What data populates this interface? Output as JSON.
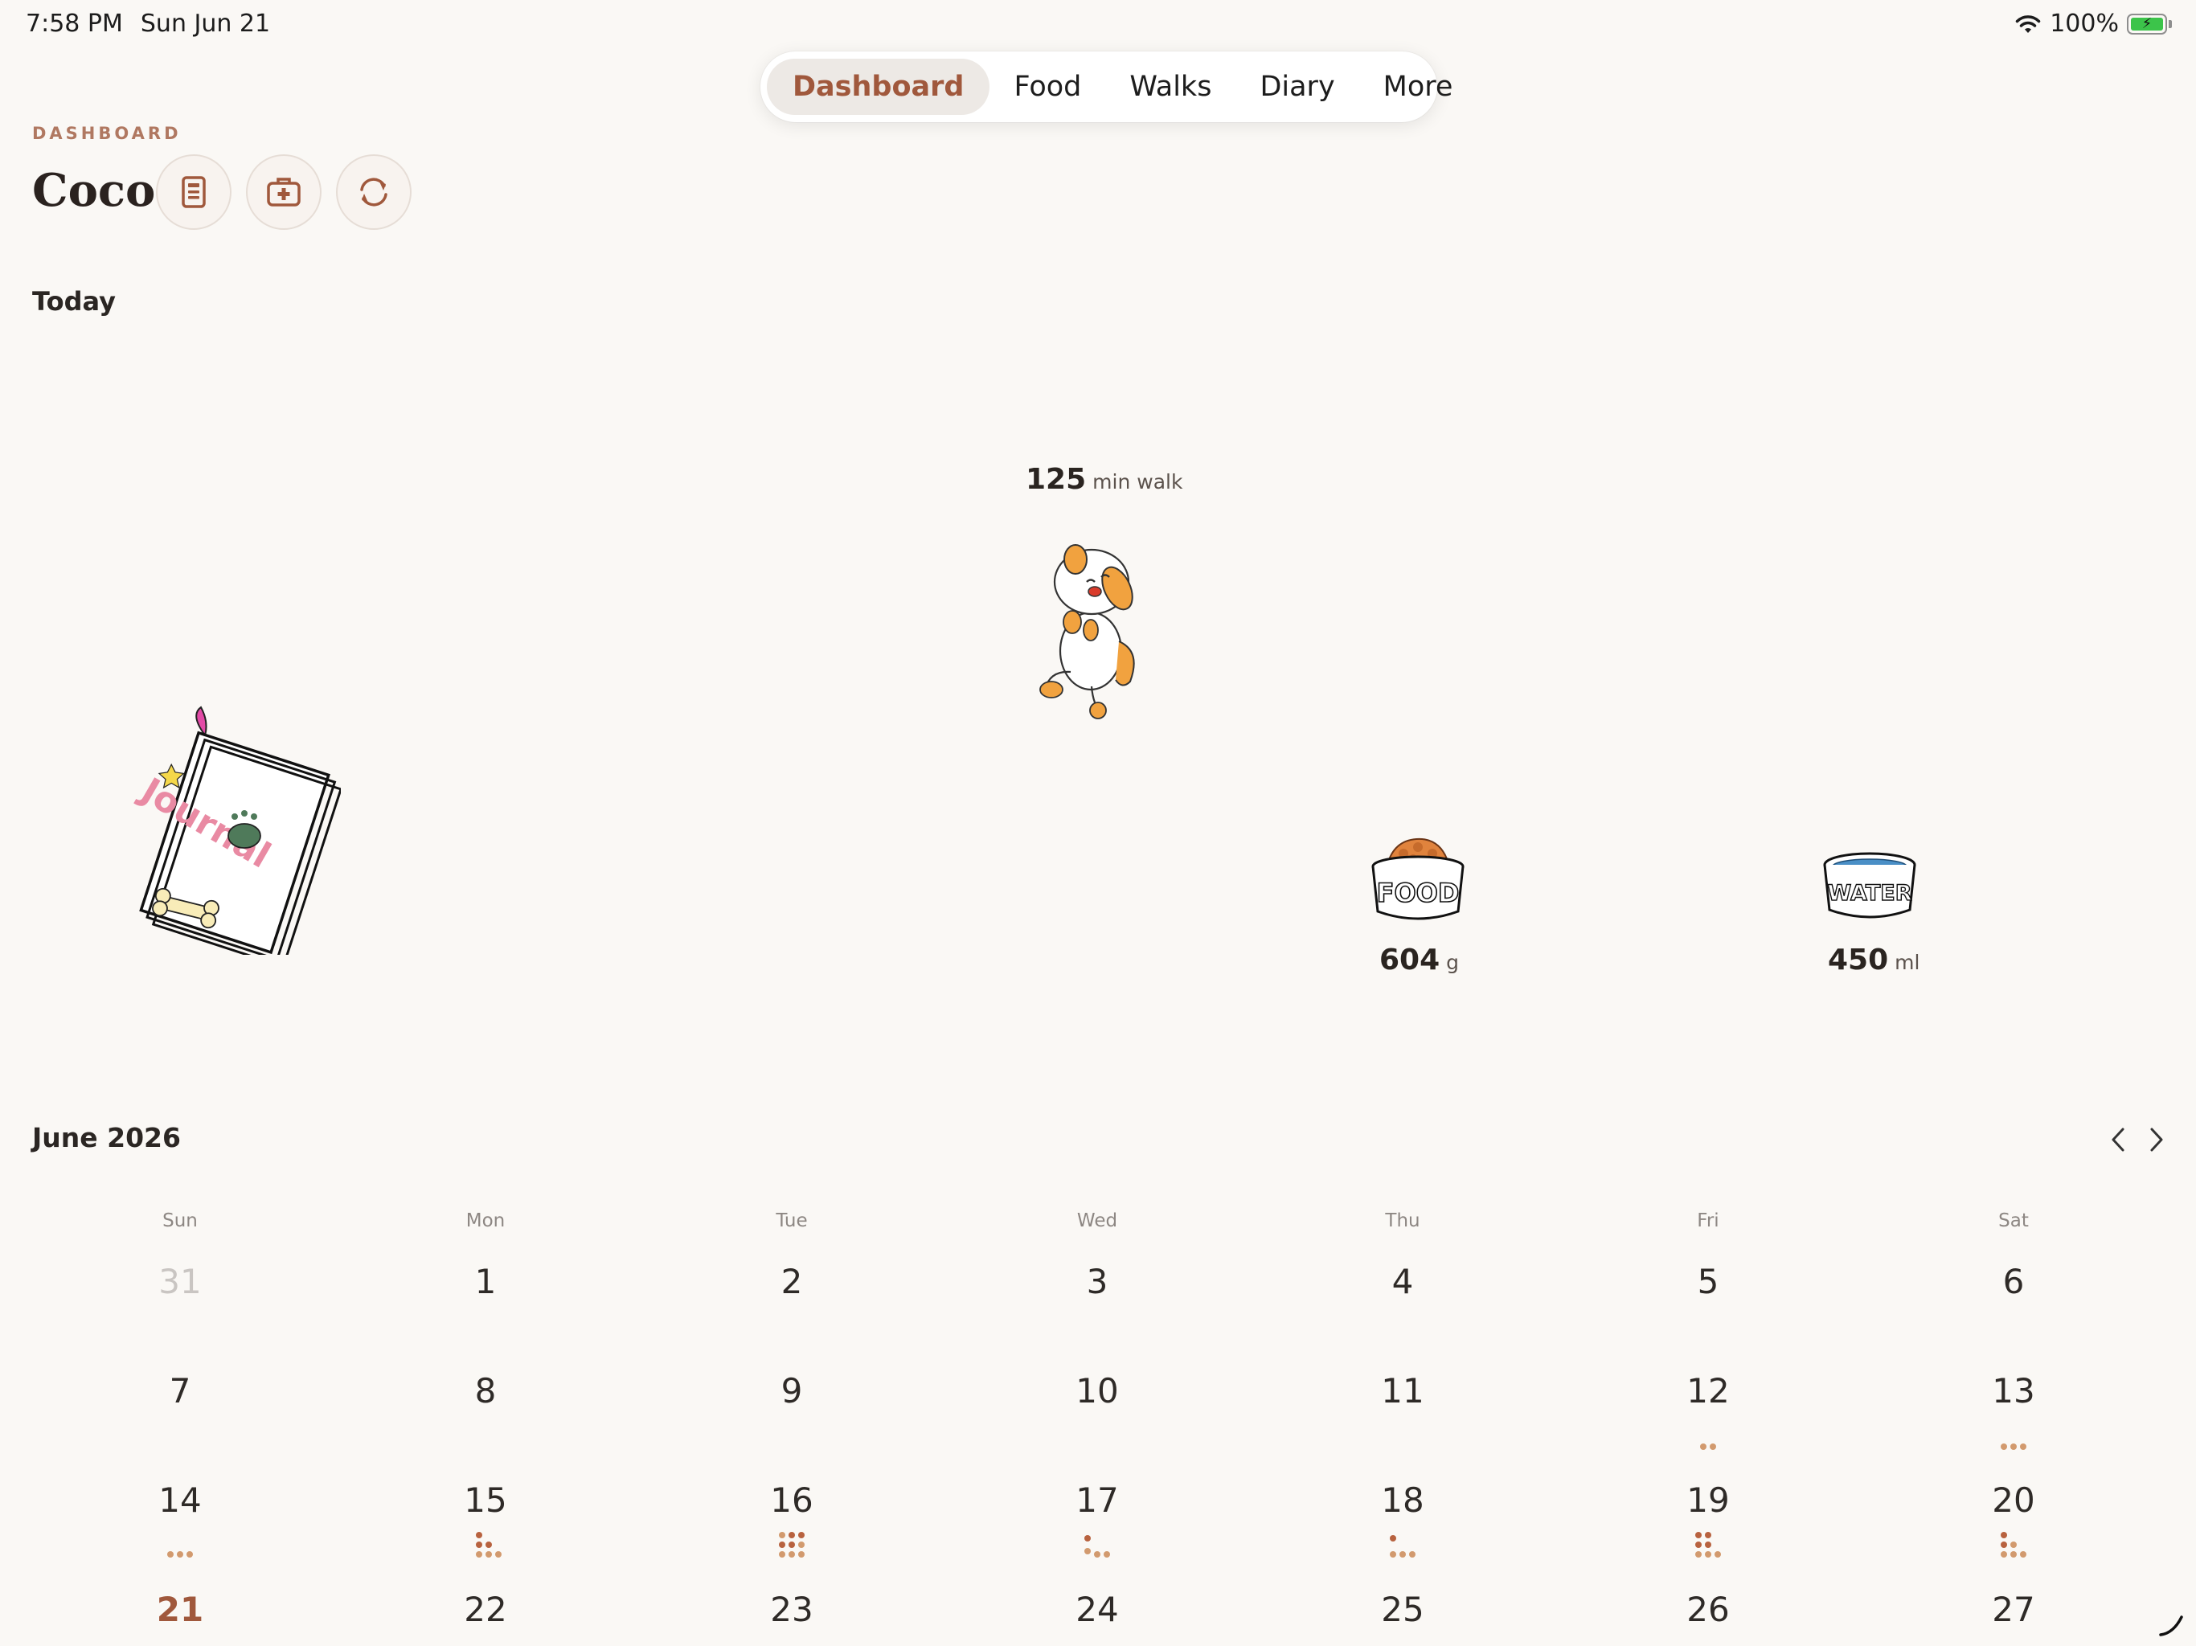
{
  "status_bar": {
    "time": "7:58 PM",
    "date": "Sun Jun 21",
    "battery": "100%"
  },
  "nav": {
    "tabs": [
      {
        "label": "Dashboard",
        "active": true
      },
      {
        "label": "Food"
      },
      {
        "label": "Walks"
      },
      {
        "label": "Diary"
      },
      {
        "label": "More"
      }
    ]
  },
  "header": {
    "eyebrow": "DASHBOARD",
    "pet_name": "Coco"
  },
  "today": {
    "title": "Today",
    "walk": {
      "value": "125",
      "unit": "min walk"
    },
    "food": {
      "value": "604",
      "unit": "g",
      "bowl_label": "FOOD"
    },
    "water": {
      "value": "450",
      "unit": "ml",
      "bowl_label": "WATER"
    },
    "journal_label": "Journal"
  },
  "calendar": {
    "month": "June 2026",
    "weekdays": [
      "Sun",
      "Mon",
      "Tue",
      "Wed",
      "Thu",
      "Fri",
      "Sat"
    ],
    "weeks": [
      [
        "31",
        "1",
        "2",
        "3",
        "4",
        "5",
        "6"
      ],
      [
        "7",
        "8",
        "9",
        "10",
        "11",
        "12",
        "13"
      ],
      [
        "14",
        "15",
        "16",
        "17",
        "18",
        "19",
        "20"
      ],
      [
        "21",
        "22",
        "23",
        "24",
        "25",
        "26",
        "27"
      ]
    ],
    "today": "21",
    "accent_color": "#a0583c"
  }
}
